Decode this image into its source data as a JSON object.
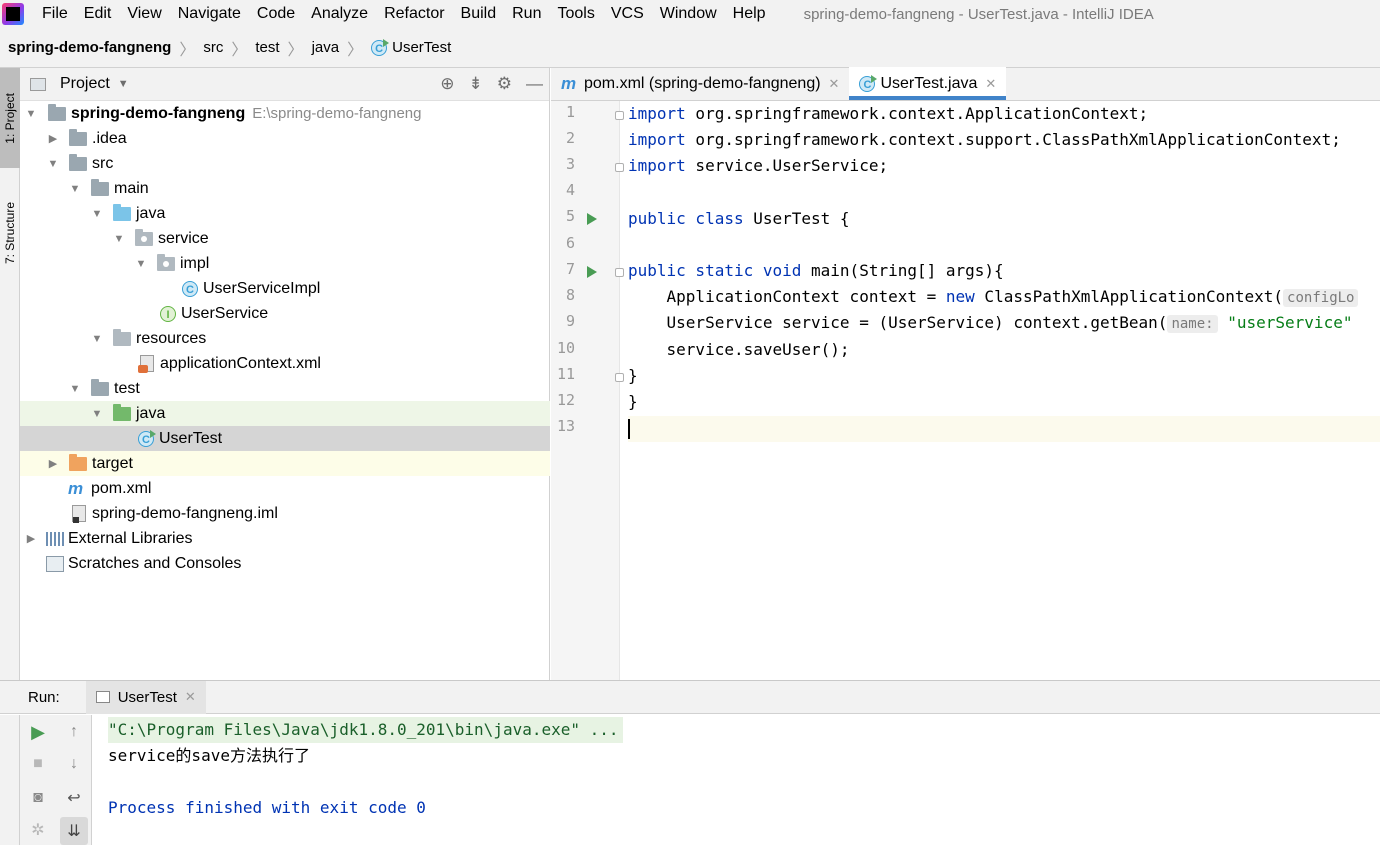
{
  "menubar": {
    "items": [
      "File",
      "Edit",
      "View",
      "Navigate",
      "Code",
      "Analyze",
      "Refactor",
      "Build",
      "Run",
      "Tools",
      "VCS",
      "Window",
      "Help"
    ],
    "window_title": "spring-demo-fangneng - UserTest.java - IntelliJ IDEA"
  },
  "breadcrumb": [
    "spring-demo-fangneng",
    "src",
    "test",
    "java",
    "UserTest"
  ],
  "left_strip": {
    "project_tab": "1: Project",
    "structure_tab": "7: Structure"
  },
  "project_panel": {
    "title": "Project",
    "tree": [
      {
        "label": "spring-demo-fangneng",
        "path": "E:\\spring-demo-fangneng"
      },
      {
        "label": ".idea"
      },
      {
        "label": "src"
      },
      {
        "label": "main"
      },
      {
        "label": "java"
      },
      {
        "label": "service"
      },
      {
        "label": "impl"
      },
      {
        "label": "UserServiceImpl"
      },
      {
        "label": "UserService"
      },
      {
        "label": "resources"
      },
      {
        "label": "applicationContext.xml"
      },
      {
        "label": "test"
      },
      {
        "label": "java"
      },
      {
        "label": "UserTest"
      },
      {
        "label": "target"
      },
      {
        "label": "pom.xml"
      },
      {
        "label": "spring-demo-fangneng.iml"
      },
      {
        "label": "External Libraries"
      },
      {
        "label": "Scratches and Consoles"
      }
    ]
  },
  "editor": {
    "tabs": [
      {
        "label": "pom.xml (spring-demo-fangneng)",
        "icon": "maven-icon"
      },
      {
        "label": "UserTest.java",
        "icon": "class-icon",
        "active": true
      }
    ],
    "line_numbers": [
      "1",
      "2",
      "3",
      "4",
      "5",
      "6",
      "7",
      "8",
      "9",
      "10",
      "11",
      "12",
      "13"
    ],
    "code": {
      "l1_kw": "import",
      "l1_rest": " org.springframework.context.ApplicationContext;",
      "l2_kw": "import",
      "l2_rest": " org.springframework.context.support.ClassPathXmlApplicationContext;",
      "l3_kw": "import",
      "l3_rest": " service.UserService;",
      "l5_kw": "public class",
      "l5_rest": " UserTest {",
      "l7_kw": "public static void",
      "l7_rest": " main(String[] args){",
      "l8_a": "    ApplicationContext context = ",
      "l8_kw": "new",
      "l8_b": " ClassPathXmlApplicationContext(",
      "l8_hint": "configLo",
      "l9_a": "    UserService service = (UserService) context.getBean(",
      "l9_hint": "name:",
      "l9_str": "\"userService\"",
      "l10": "    service.saveUser();",
      "l11": "}",
      "l12": "}"
    }
  },
  "run_panel": {
    "label": "Run:",
    "tab": "UserTest",
    "console": {
      "cmd": "\"C:\\Program Files\\Java\\jdk1.8.0_201\\bin\\java.exe\" ...",
      "output": "service的save方法执行了",
      "exit": "Process finished with exit code 0"
    }
  },
  "colors": {
    "keyword": "#0033b3",
    "string": "#067d17",
    "accent": "#4083c9",
    "run_green": "#499c54"
  }
}
